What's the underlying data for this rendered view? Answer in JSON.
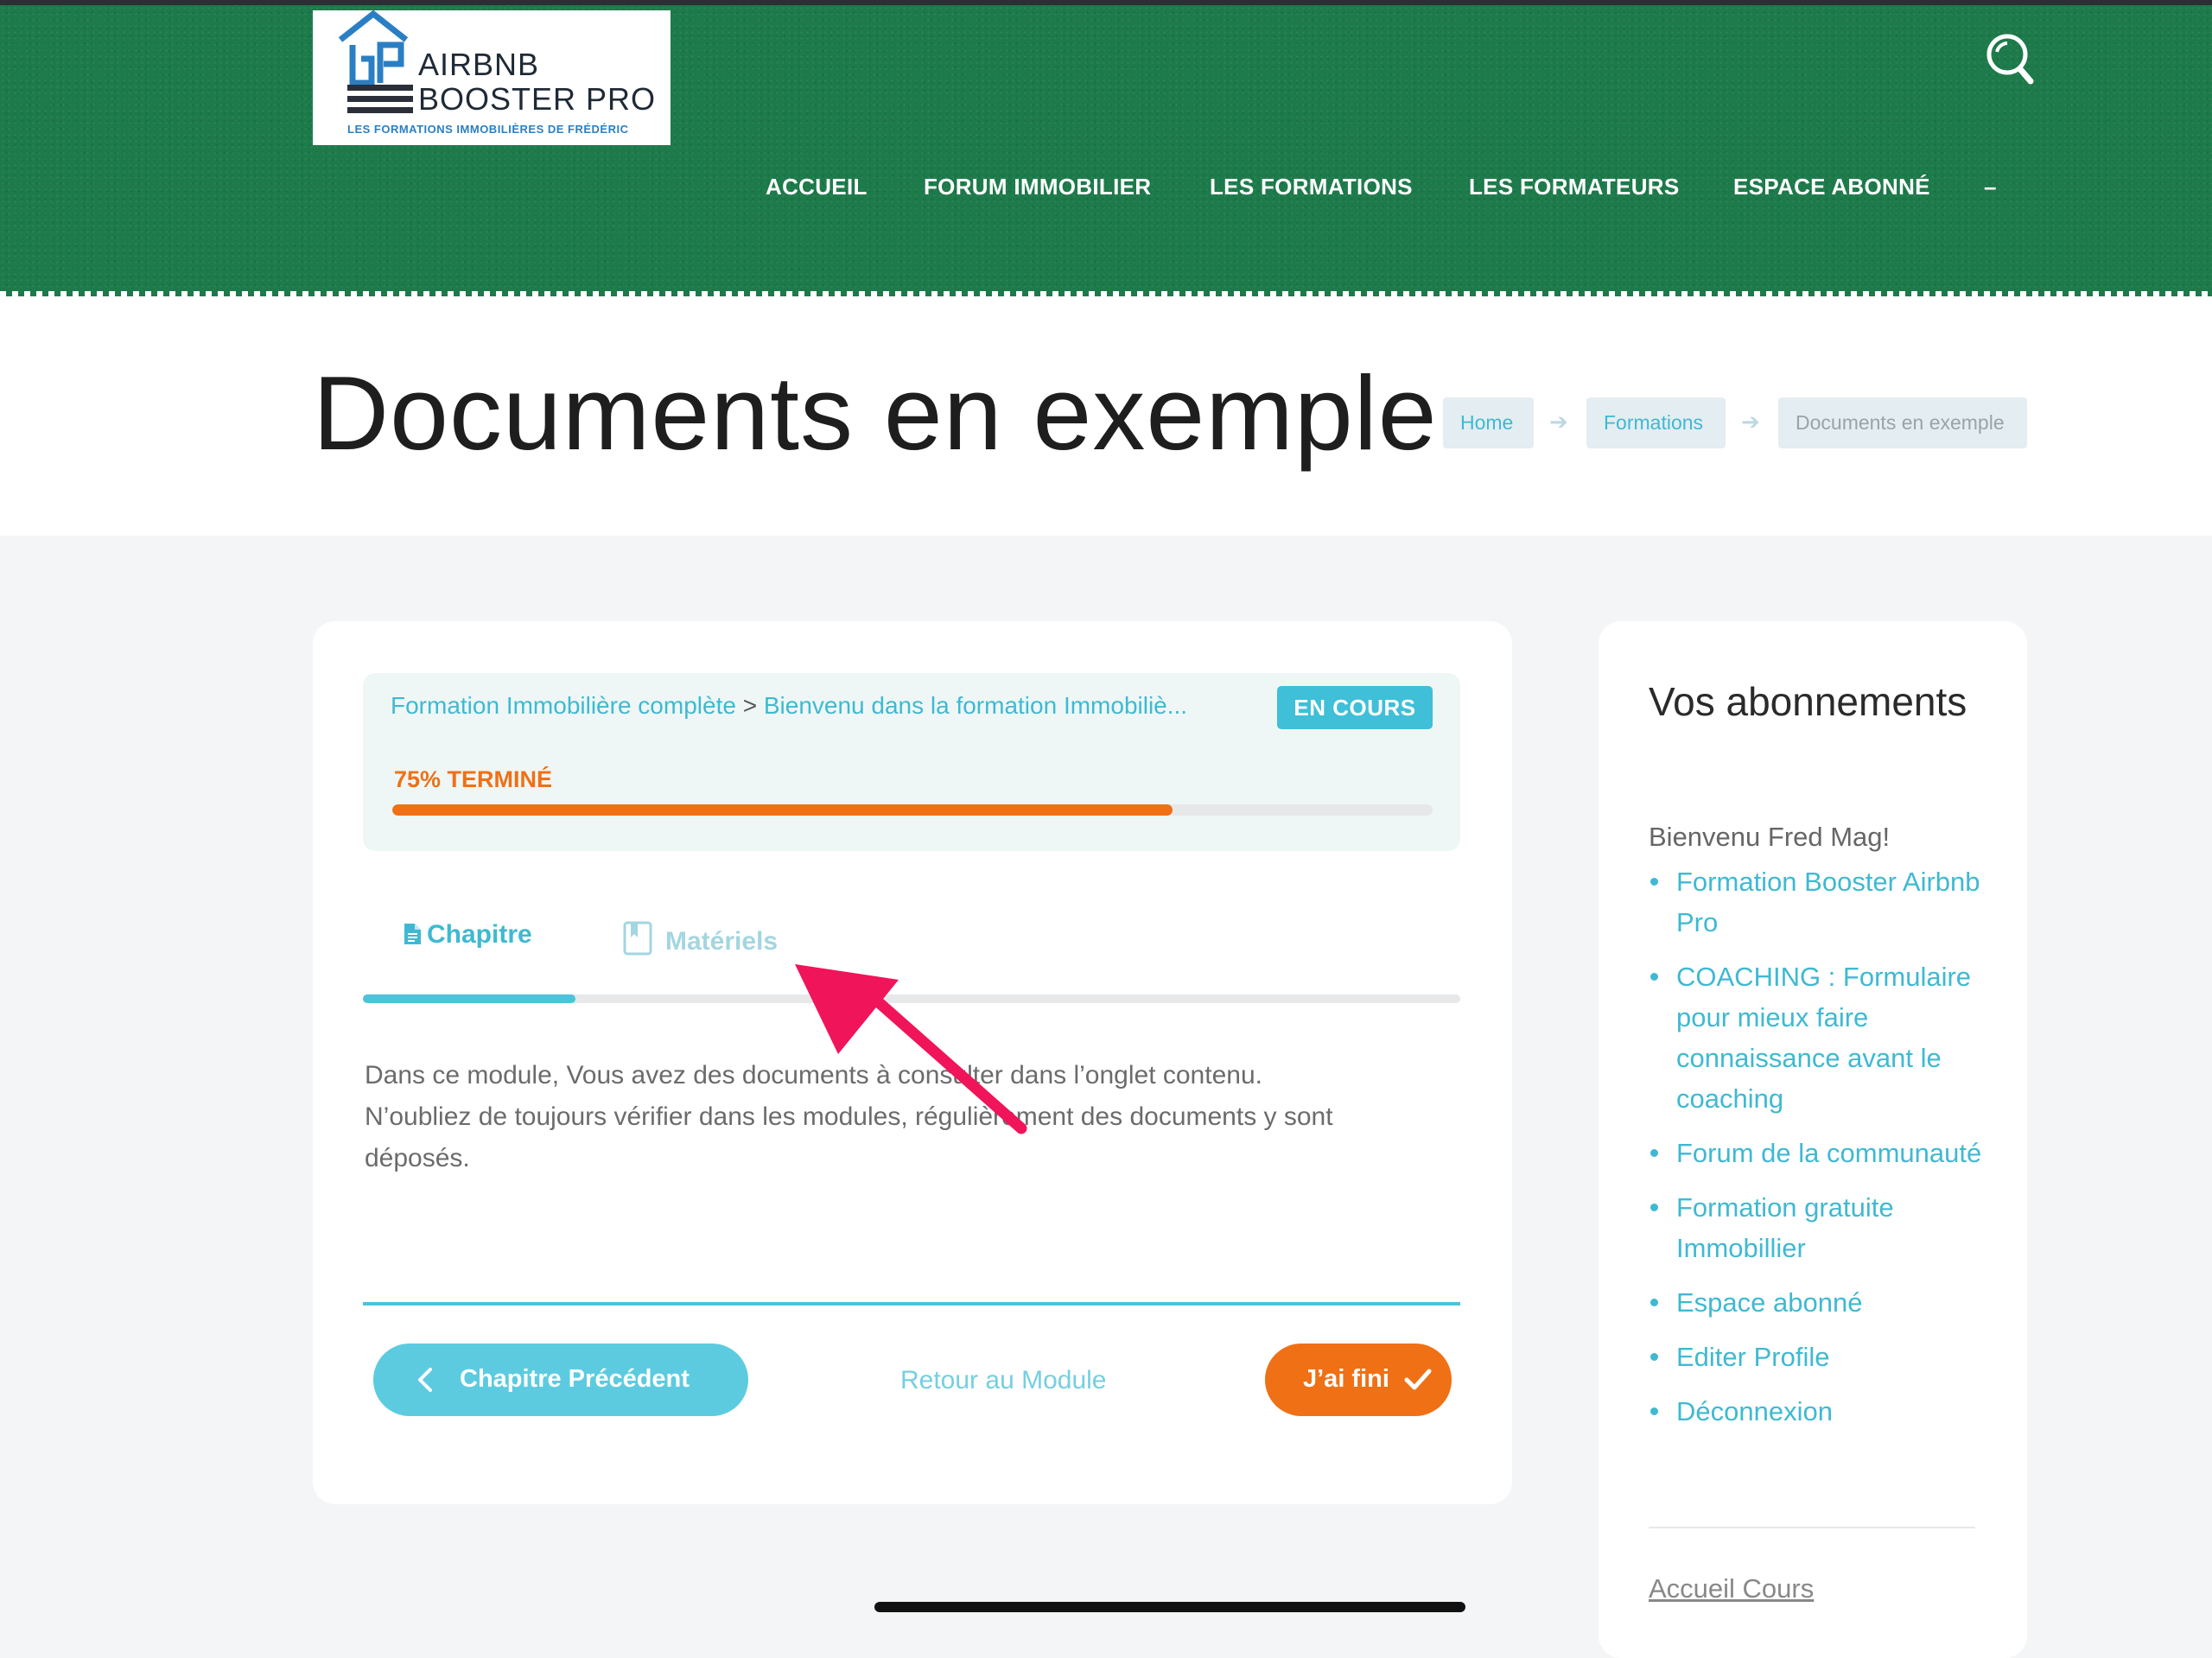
{
  "brand": {
    "line1": "AIRBNB",
    "line2": "BOOSTER PRO",
    "tagline": "LES FORMATIONS IMMOBILIÈRES DE FRÉDÉRIC",
    "accent_color": "#2a7fc4"
  },
  "nav": {
    "items": [
      "ACCUEIL",
      "FORUM IMMOBILIER",
      "LES FORMATIONS",
      "LES FORMATEURS",
      "ESPACE ABONNÉ",
      "–"
    ],
    "search_icon": "search-icon"
  },
  "page": {
    "title": "Documents en exemple",
    "breadcrumb": [
      "Home",
      "Formations",
      "Documents en exemple"
    ]
  },
  "course": {
    "path_course": "Formation Immobilière complète",
    "path_separator": " > ",
    "path_lesson": "Bienvenu dans la formation Immobiliè...",
    "status": "EN COURS",
    "progress_label": "75% TERMINÉ",
    "progress_fraction": 0.75
  },
  "tabs": {
    "chapitre": "Chapitre",
    "materiels": "Matériels",
    "active": "chapitre"
  },
  "content": {
    "line1": "Dans ce module, Vous avez des documents à consulter dans l’onglet contenu.",
    "line2": "N’oubliez de toujours vérifier dans les modules, régulièrement des documents y sont déposés."
  },
  "footer_nav": {
    "prev": "Chapitre Précédent",
    "back": "Retour au Module",
    "done": "J’ai fini"
  },
  "sidebar": {
    "title": "Vos abonnements",
    "welcome": "Bienvenu Fred Mag!",
    "items": [
      "Formation Booster Airbnb Pro",
      "COACHING : Formulaire pour mieux faire connaissance avant le coaching",
      "Forum de la communauté",
      "Formation gratuite Immobillier",
      "Espace abonné",
      "Editer Profile",
      "Déconnexion"
    ],
    "footer_link": "Accueil Cours"
  },
  "colors": {
    "header_green": "#1d7a4a",
    "accent_teal": "#3fb9d2",
    "accent_orange": "#f07015",
    "annotation_pink": "#f0145a"
  }
}
